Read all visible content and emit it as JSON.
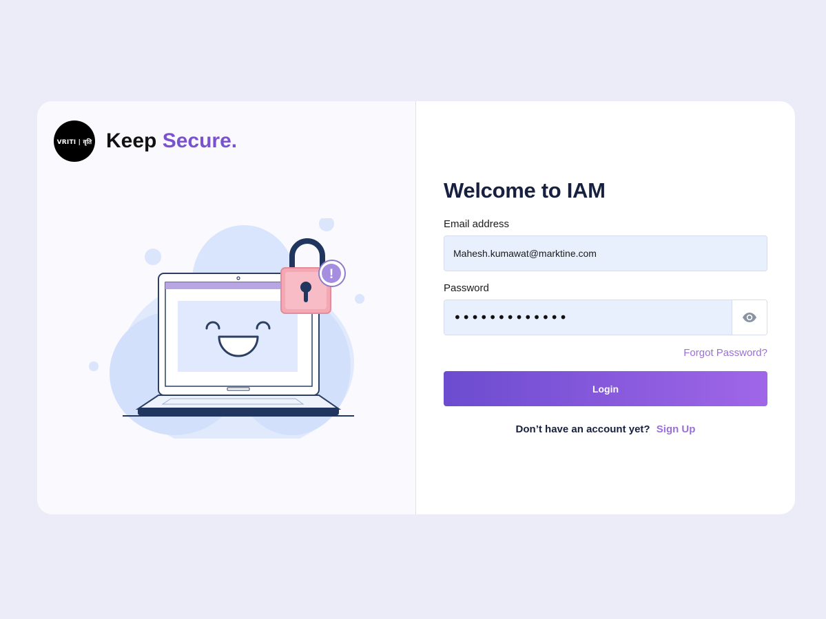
{
  "brand": {
    "logo_text": "VRITI | वृति",
    "tagline_part1": "Keep ",
    "tagline_part2": "Secure."
  },
  "illustration": {
    "name": "laptop-lock-illustration",
    "alert_symbol": "!"
  },
  "form": {
    "title": "Welcome to IAM",
    "email_label": "Email address",
    "email_value": "Mahesh.kumawat@marktine.com",
    "password_label": "Password",
    "password_value": "•••••••••••••",
    "show_password_icon": "eye-icon",
    "forgot_password": "Forgot Password?",
    "login_button": "Login",
    "signup_prompt": "Don’t have an account yet?",
    "signup_link": "Sign Up"
  },
  "colors": {
    "page_background": "#ecebf8",
    "accent": "#7a52cf",
    "link": "#9b6fd8",
    "input_background": "#e8f0fe",
    "button_gradient_start": "#6c4ccf",
    "button_gradient_end": "#a066e8",
    "heading": "#17213f"
  }
}
